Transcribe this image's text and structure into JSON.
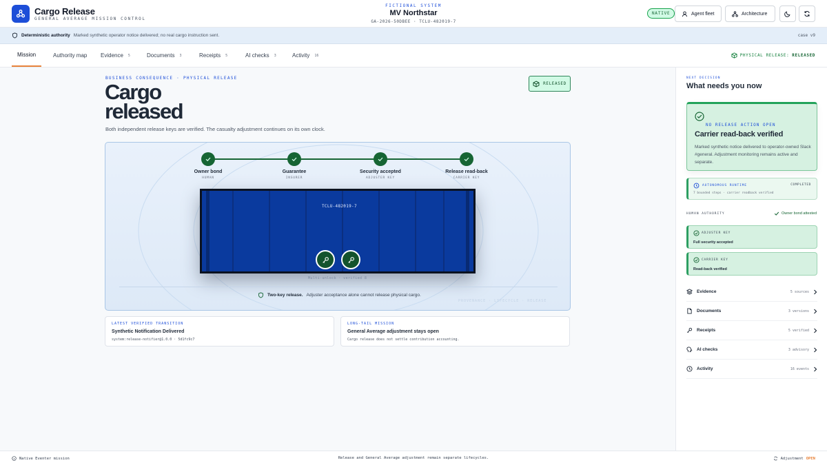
{
  "app": {
    "title": "Cargo Release",
    "subtitle": "GENERAL AVERAGE MISSION CONTROL"
  },
  "system": {
    "label": "FICTIONAL SYSTEM",
    "ship": "MV Northstar",
    "ids": "GA-2026-50DBEE · TCLU-482019-7"
  },
  "header": {
    "native_badge": "NATIVE",
    "agent_fleet": "Agent fleet",
    "architecture": "Architecture"
  },
  "notice": {
    "bold": "Deterministic authority",
    "text": "Marked synthetic operator notice delivered; no real cargo instruction sent.",
    "case": "case v9"
  },
  "tabs": [
    {
      "label": "Mission",
      "count": ""
    },
    {
      "label": "Authority map",
      "count": ""
    },
    {
      "label": "Evidence",
      "count": "5"
    },
    {
      "label": "Documents",
      "count": "3"
    },
    {
      "label": "Receipts",
      "count": "5"
    },
    {
      "label": "AI checks",
      "count": "3"
    },
    {
      "label": "Activity",
      "count": "16"
    }
  ],
  "physical_release": {
    "label": "PHYSICAL RELEASE:",
    "value": "RELEASED"
  },
  "main": {
    "kicker": "BUSINESS CONSEQUENCE · PHYSICAL RELEASE",
    "headline_1": "Cargo",
    "headline_2": "released",
    "subtitle": "Both independent release keys are verified. The casualty adjustment continues on its own clock.",
    "badge": "RELEASED"
  },
  "steps": [
    {
      "label": "Owner bond",
      "role": "HUMAN"
    },
    {
      "label": "Guarantee",
      "role": "INSURER"
    },
    {
      "label": "Security accepted",
      "role": "ADJUSTER KEY"
    },
    {
      "label": "Release read-back",
      "role": "CARRIER KEY"
    }
  ],
  "container": {
    "tag": "TCLU-482019-7"
  },
  "multisig": "Multi-unlock · verified 8",
  "twokey": {
    "bold": "Two-key release.",
    "text": "Adjuster acceptance alone cannot release physical cargo."
  },
  "ghost_text": "PROVENANCE · LIFECYCLE · RELEASE",
  "cards": [
    {
      "kicker": "LATEST VERIFIED TRANSITION",
      "title": "Synthetic Notification Delivered",
      "sub": "system:release-notifier@1.0.0 · 5d1fc9c7"
    },
    {
      "kicker": "LONG-TAIL MISSION",
      "title": "General Average adjustment stays open",
      "sub": "Cargo release does not settle contribution accounting."
    }
  ],
  "right": {
    "next_decision": "NEXT DECISION",
    "what_now": "What needs you now",
    "focus": {
      "tag": "NO RELEASE ACTION OPEN",
      "title": "Carrier read-back verified",
      "body": "Marked synthetic notice delivered to operator-owned Slack #general. Adjustment monitoring remains active and separate."
    },
    "autonomous": {
      "label": "AUTONOMOUS RUNTIME",
      "status": "COMPLETED",
      "sub": "7 bounded steps · carrier readback verified"
    },
    "human_authority": "HUMAN AUTHORITY",
    "owner_bond": "Owner bond attested",
    "keys": [
      {
        "label": "ADJUSTER KEY",
        "value": "Full security accepted"
      },
      {
        "label": "CARRIER KEY",
        "value": "Read-back verified"
      }
    ],
    "nav": [
      {
        "label": "Evidence",
        "count": "5 sources",
        "icon": "layers-icon"
      },
      {
        "label": "Documents",
        "count": "3 versions",
        "icon": "document-icon"
      },
      {
        "label": "Receipts",
        "count": "5 verified",
        "icon": "key-icon"
      },
      {
        "label": "AI checks",
        "count": "3 advisory",
        "icon": "ai-icon"
      },
      {
        "label": "Activity",
        "count": "16 events",
        "icon": "clock-icon"
      }
    ]
  },
  "footer": {
    "left": "Native Eventer mission",
    "center": "Release and General Average adjustment remain separate lifecycles.",
    "right_label": "Adjustment",
    "right_status": "OPEN"
  },
  "colors": {
    "brand": "#1d4ed8",
    "success": "#166534",
    "accent": "#e8833a",
    "container": "#0a3a9e"
  }
}
